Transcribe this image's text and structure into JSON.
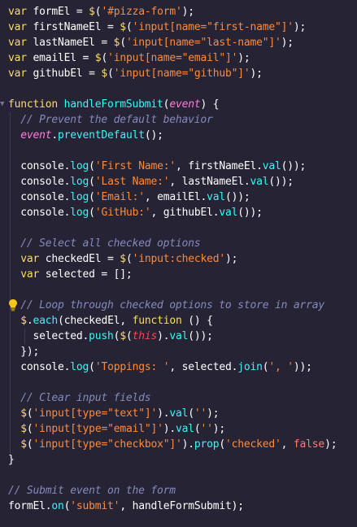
{
  "editor": {
    "theme_colors": {
      "background": "#262335",
      "keyword": "#fede5d",
      "function": "#36f9f6",
      "string": "#ff8b39",
      "comment": "#848bbd",
      "param": "#ff7edb",
      "this": "#fe4450",
      "boolean": "#f97e72"
    },
    "lines": [
      [
        {
          "t": "var ",
          "c": "keyword"
        },
        {
          "t": "formEl = ",
          "c": "plain"
        },
        {
          "t": "$",
          "c": "keyword"
        },
        {
          "t": "(",
          "c": "paren"
        },
        {
          "t": "'#pizza-form'",
          "c": "string"
        },
        {
          "t": ");",
          "c": "plain"
        }
      ],
      [
        {
          "t": "var ",
          "c": "keyword"
        },
        {
          "t": "firstNameEl = ",
          "c": "plain"
        },
        {
          "t": "$",
          "c": "keyword"
        },
        {
          "t": "(",
          "c": "paren"
        },
        {
          "t": "'input[name=\"first-name\"]'",
          "c": "string"
        },
        {
          "t": ");",
          "c": "plain"
        }
      ],
      [
        {
          "t": "var ",
          "c": "keyword"
        },
        {
          "t": "lastNameEl = ",
          "c": "plain"
        },
        {
          "t": "$",
          "c": "keyword"
        },
        {
          "t": "(",
          "c": "paren"
        },
        {
          "t": "'input[name=\"last-name\"]'",
          "c": "string"
        },
        {
          "t": ");",
          "c": "plain"
        }
      ],
      [
        {
          "t": "var ",
          "c": "keyword"
        },
        {
          "t": "emailEl = ",
          "c": "plain"
        },
        {
          "t": "$",
          "c": "keyword"
        },
        {
          "t": "(",
          "c": "paren"
        },
        {
          "t": "'input[name=\"email\"]'",
          "c": "string"
        },
        {
          "t": ");",
          "c": "plain"
        }
      ],
      [
        {
          "t": "var ",
          "c": "keyword"
        },
        {
          "t": "githubEl = ",
          "c": "plain"
        },
        {
          "t": "$",
          "c": "keyword"
        },
        {
          "t": "(",
          "c": "paren"
        },
        {
          "t": "'input[name=\"github\"]'",
          "c": "string"
        },
        {
          "t": ");",
          "c": "plain"
        }
      ],
      [],
      [
        {
          "t": "function ",
          "c": "keyword"
        },
        {
          "t": "handleFormSubmit",
          "c": "func"
        },
        {
          "t": "(",
          "c": "paren"
        },
        {
          "t": "event",
          "c": "param"
        },
        {
          "t": ") {",
          "c": "plain"
        }
      ],
      [
        {
          "t": "  // Prevent the default behavior",
          "c": "comment"
        }
      ],
      [
        {
          "t": "  ",
          "c": "plain"
        },
        {
          "t": "event",
          "c": "param"
        },
        {
          "t": ".",
          "c": "plain"
        },
        {
          "t": "preventDefault",
          "c": "func"
        },
        {
          "t": "();",
          "c": "plain"
        }
      ],
      [],
      [
        {
          "t": "  console.",
          "c": "plain"
        },
        {
          "t": "log",
          "c": "func"
        },
        {
          "t": "(",
          "c": "paren"
        },
        {
          "t": "'First Name:'",
          "c": "string"
        },
        {
          "t": ", firstNameEl.",
          "c": "plain"
        },
        {
          "t": "val",
          "c": "func"
        },
        {
          "t": "());",
          "c": "plain"
        }
      ],
      [
        {
          "t": "  console.",
          "c": "plain"
        },
        {
          "t": "log",
          "c": "func"
        },
        {
          "t": "(",
          "c": "paren"
        },
        {
          "t": "'Last Name:'",
          "c": "string"
        },
        {
          "t": ", lastNameEl.",
          "c": "plain"
        },
        {
          "t": "val",
          "c": "func"
        },
        {
          "t": "());",
          "c": "plain"
        }
      ],
      [
        {
          "t": "  console.",
          "c": "plain"
        },
        {
          "t": "log",
          "c": "func"
        },
        {
          "t": "(",
          "c": "paren"
        },
        {
          "t": "'Email:'",
          "c": "string"
        },
        {
          "t": ", emailEl.",
          "c": "plain"
        },
        {
          "t": "val",
          "c": "func"
        },
        {
          "t": "());",
          "c": "plain"
        }
      ],
      [
        {
          "t": "  console.",
          "c": "plain"
        },
        {
          "t": "log",
          "c": "func"
        },
        {
          "t": "(",
          "c": "paren"
        },
        {
          "t": "'GitHub:'",
          "c": "string"
        },
        {
          "t": ", githubEl.",
          "c": "plain"
        },
        {
          "t": "val",
          "c": "func"
        },
        {
          "t": "());",
          "c": "plain"
        }
      ],
      [],
      [
        {
          "t": "  // Select all checked options",
          "c": "comment"
        }
      ],
      [
        {
          "t": "  var ",
          "c": "keyword"
        },
        {
          "t": "checkedEl = ",
          "c": "plain"
        },
        {
          "t": "$",
          "c": "keyword"
        },
        {
          "t": "(",
          "c": "paren"
        },
        {
          "t": "'input:checked'",
          "c": "string"
        },
        {
          "t": ");",
          "c": "plain"
        }
      ],
      [
        {
          "t": "  var ",
          "c": "keyword"
        },
        {
          "t": "selected = [];",
          "c": "plain"
        }
      ],
      [],
      [
        {
          "t": "  // Loop through checked options to store in array",
          "c": "comment"
        }
      ],
      [
        {
          "t": "  ",
          "c": "plain"
        },
        {
          "t": "$",
          "c": "keyword"
        },
        {
          "t": ".",
          "c": "plain"
        },
        {
          "t": "each",
          "c": "func"
        },
        {
          "t": "(checkedEl, ",
          "c": "plain"
        },
        {
          "t": "function ",
          "c": "keyword"
        },
        {
          "t": "() {",
          "c": "plain"
        }
      ],
      [
        {
          "t": "    selected.",
          "c": "plain"
        },
        {
          "t": "push",
          "c": "func"
        },
        {
          "t": "(",
          "c": "paren"
        },
        {
          "t": "$",
          "c": "keyword"
        },
        {
          "t": "(",
          "c": "paren"
        },
        {
          "t": "this",
          "c": "this"
        },
        {
          "t": ").",
          "c": "plain"
        },
        {
          "t": "val",
          "c": "func"
        },
        {
          "t": "());",
          "c": "plain"
        }
      ],
      [
        {
          "t": "  });",
          "c": "plain"
        }
      ],
      [
        {
          "t": "  console.",
          "c": "plain"
        },
        {
          "t": "log",
          "c": "func"
        },
        {
          "t": "(",
          "c": "paren"
        },
        {
          "t": "'Toppings: '",
          "c": "string"
        },
        {
          "t": ", selected.",
          "c": "plain"
        },
        {
          "t": "join",
          "c": "func"
        },
        {
          "t": "(",
          "c": "paren"
        },
        {
          "t": "', '",
          "c": "string"
        },
        {
          "t": "));",
          "c": "plain"
        }
      ],
      [],
      [
        {
          "t": "  // Clear input fields",
          "c": "comment"
        }
      ],
      [
        {
          "t": "  ",
          "c": "plain"
        },
        {
          "t": "$",
          "c": "keyword"
        },
        {
          "t": "(",
          "c": "paren"
        },
        {
          "t": "'input[type=\"text\"]'",
          "c": "string"
        },
        {
          "t": ").",
          "c": "plain"
        },
        {
          "t": "val",
          "c": "func"
        },
        {
          "t": "(",
          "c": "paren"
        },
        {
          "t": "''",
          "c": "string"
        },
        {
          "t": ");",
          "c": "plain"
        }
      ],
      [
        {
          "t": "  ",
          "c": "plain"
        },
        {
          "t": "$",
          "c": "keyword"
        },
        {
          "t": "(",
          "c": "paren"
        },
        {
          "t": "'input[type=\"email\"]'",
          "c": "string"
        },
        {
          "t": ").",
          "c": "plain"
        },
        {
          "t": "val",
          "c": "func"
        },
        {
          "t": "(",
          "c": "paren"
        },
        {
          "t": "''",
          "c": "string"
        },
        {
          "t": ");",
          "c": "plain"
        }
      ],
      [
        {
          "t": "  ",
          "c": "plain"
        },
        {
          "t": "$",
          "c": "keyword"
        },
        {
          "t": "(",
          "c": "paren"
        },
        {
          "t": "'input[type=\"checkbox\"]'",
          "c": "string"
        },
        {
          "t": ").",
          "c": "plain"
        },
        {
          "t": "prop",
          "c": "func"
        },
        {
          "t": "(",
          "c": "paren"
        },
        {
          "t": "'checked'",
          "c": "string"
        },
        {
          "t": ", ",
          "c": "plain"
        },
        {
          "t": "false",
          "c": "bool"
        },
        {
          "t": ");",
          "c": "plain"
        }
      ],
      [
        {
          "t": "}",
          "c": "plain"
        }
      ],
      [],
      [
        {
          "t": "// Submit event on the form",
          "c": "comment"
        }
      ],
      [
        {
          "t": "formEl.",
          "c": "plain"
        },
        {
          "t": "on",
          "c": "func"
        },
        {
          "t": "(",
          "c": "paren"
        },
        {
          "t": "'submit'",
          "c": "string"
        },
        {
          "t": ", handleFormSubmit);",
          "c": "plain"
        }
      ]
    ],
    "icons": {
      "fold": "chevron-down-icon",
      "lightbulb": "lightbulb-icon"
    }
  }
}
